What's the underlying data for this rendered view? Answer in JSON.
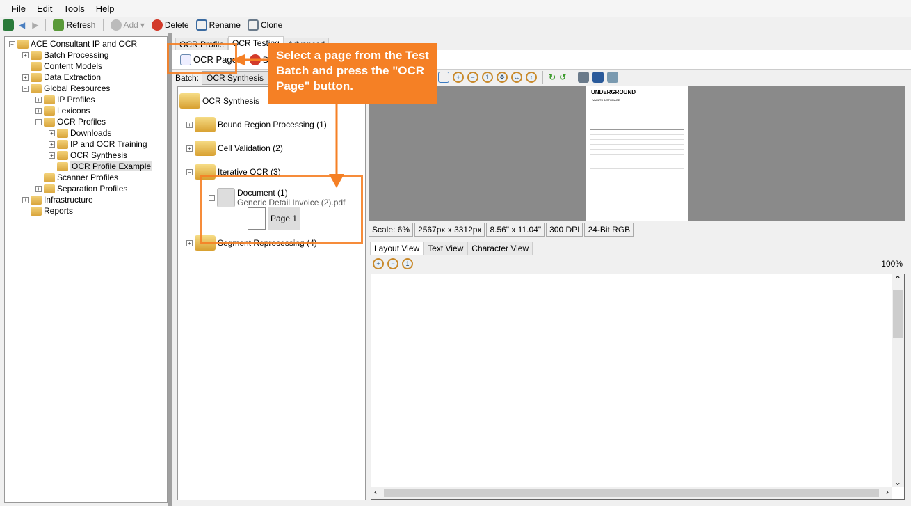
{
  "menu": [
    "File",
    "Edit",
    "Tools",
    "Help"
  ],
  "toolbar": {
    "refresh": "Refresh",
    "add": "Add",
    "delete": "Delete",
    "rename": "Rename",
    "clone": "Clone"
  },
  "left_tree": [
    {
      "label": "ACE Consultant IP and OCR",
      "depth": 0,
      "exp": "-"
    },
    {
      "label": "Batch Processing",
      "depth": 1,
      "exp": "+"
    },
    {
      "label": "Content Models",
      "depth": 1,
      "exp": ""
    },
    {
      "label": "Data Extraction",
      "depth": 1,
      "exp": "+"
    },
    {
      "label": "Global Resources",
      "depth": 1,
      "exp": "-"
    },
    {
      "label": "IP Profiles",
      "depth": 2,
      "exp": "+"
    },
    {
      "label": "Lexicons",
      "depth": 2,
      "exp": "+"
    },
    {
      "label": "OCR Profiles",
      "depth": 2,
      "exp": "-"
    },
    {
      "label": "Downloads",
      "depth": 3,
      "exp": "+"
    },
    {
      "label": "IP and OCR Training",
      "depth": 3,
      "exp": "+"
    },
    {
      "label": "OCR Synthesis",
      "depth": 3,
      "exp": "+"
    },
    {
      "label": "OCR Profile Example",
      "depth": 3,
      "exp": "",
      "selected": true
    },
    {
      "label": "Scanner Profiles",
      "depth": 2,
      "exp": ""
    },
    {
      "label": "Separation Profiles",
      "depth": 2,
      "exp": "+"
    },
    {
      "label": "Infrastructure",
      "depth": 1,
      "exp": "+"
    },
    {
      "label": "Reports",
      "depth": 1,
      "exp": ""
    }
  ],
  "tabs": [
    "OCR Profile",
    "OCR Testing",
    "Advanced"
  ],
  "subbar": {
    "ocr_page": "OCR Page",
    "delete": "Delete"
  },
  "batch": {
    "label": "Batch:",
    "value": "OCR Synthesis"
  },
  "batch_tree": {
    "root": "OCR Synthesis",
    "folders": [
      "Bound Region Processing (1)",
      "Cell Validation (2)",
      "Iterative OCR (3)",
      "Segment Reprocessing (4)"
    ],
    "document": "Document (1)",
    "file": "Generic Detail Invoice (2).pdf",
    "page": "Page 1"
  },
  "preview_doc": {
    "brand": "UNDERGROUND",
    "sub": "VAULTS & STORAGE"
  },
  "status": [
    "Scale: 6%",
    "2567px x 3312px",
    "8.56\" x 11.04\"",
    "300 DPI",
    "24-Bit RGB"
  ],
  "bottom_tabs": [
    "Layout View",
    "Text View",
    "Character View"
  ],
  "zoom_level": "100%",
  "callout": "Select a page from the Test Batch and press the \"OCR Page\" button.",
  "colors": {
    "accent": "#f58025"
  }
}
